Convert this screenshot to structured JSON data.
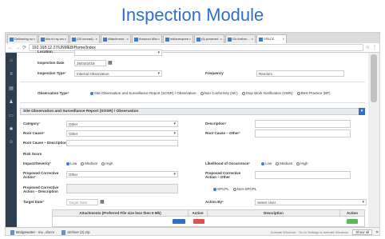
{
  "slide_title": "Inspection Module",
  "browser": {
    "tabs": [
      {
        "label": "Delivering su…",
        "active": false
      },
      {
        "label": "this is my wo…",
        "active": false
      },
      {
        "label": "(28 unread) …",
        "active": false
      },
      {
        "label": "Attachment…",
        "active": false
      },
      {
        "label": "Amazon Micr…",
        "active": false
      },
      {
        "label": "indianexpress…",
        "active": false
      },
      {
        "label": "(4) powered…",
        "active": false
      },
      {
        "label": "Go further…",
        "active": false
      },
      {
        "label": "SPACE",
        "active": true
      }
    ],
    "url": "192.168.12.27/UNMEB/Home/Index"
  },
  "form": {
    "location_label": "Location",
    "location_value": "",
    "inspection_date_label": "Inspection Date",
    "inspection_date_value": "25/03/2018",
    "inspection_type_label": "Inspection Type",
    "inspection_type_value": "Internal Observation",
    "frequency_label": "Frequency",
    "frequency_value": "Random",
    "observation_type_label": "Observation Type",
    "observation_options": [
      {
        "label": "Site Observation and Surveillance Report (SOSR) / Observation",
        "checked": true
      },
      {
        "label": "Non Conformity (NC)",
        "checked": false
      },
      {
        "label": "Stop Work Notification (SWN)",
        "checked": false
      },
      {
        "label": "Best Practice (BP)",
        "checked": false
      }
    ],
    "section_title": "Site Observation and Surveillance Report (SOSR) / Observation",
    "category_label": "Category",
    "category_value": "Other",
    "description_label": "Description",
    "root_cause_label": "Root Cause",
    "root_cause_value": "Other",
    "root_cause_other_label": "Root Cause – Other",
    "root_cause_desc_label": "Root Cause – Description",
    "risk_score_label": "Risk Score",
    "impact_label": "Impact/Severity",
    "impact_options": [
      {
        "label": "Low",
        "checked": true
      },
      {
        "label": "Medium",
        "checked": false
      },
      {
        "label": "High",
        "checked": false
      }
    ],
    "likelihood_label": "Likelihood of Occurrence",
    "likelihood_options": [
      {
        "label": "Low",
        "checked": true
      },
      {
        "label": "Medium",
        "checked": false
      },
      {
        "label": "High",
        "checked": false
      }
    ],
    "pca_label": "Proposed Corrective Action",
    "pca_value": "Other",
    "pca_other_label": "Proposed Corrective Action – Other",
    "pca_desc_label": "Proposed Corrective Action – Description",
    "spcpl_options": [
      {
        "label": "SPCPL",
        "checked": true
      },
      {
        "label": "Non-SPCPL",
        "checked": false
      }
    ],
    "target_date_label": "Target Date",
    "target_date_placeholder": "Target Date",
    "action_by_label": "Action By",
    "action_by_value": "Select User",
    "attach_header": "Attachments (Preferred File size less then 5 Mb)",
    "attach_desc_header": "Description",
    "attach_action_header": "Action",
    "attach_action_header2": "Action"
  },
  "downloads": {
    "items": [
      "Bridgewater - inv...docm",
      "archive (2).zip"
    ],
    "show_all": "Show all",
    "activate_windows": "Activate Windows",
    "activate_sub": "Go to Settings to activate Windows."
  }
}
